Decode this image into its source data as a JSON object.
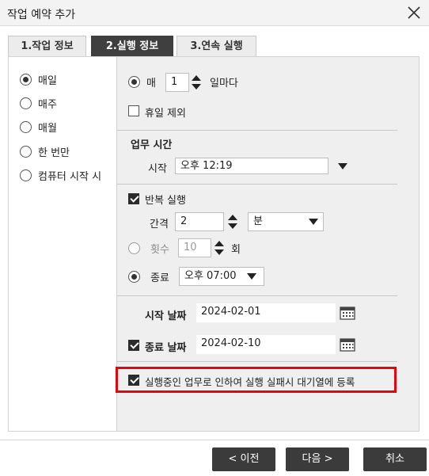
{
  "window": {
    "title": "작업 예약 추가"
  },
  "tabs": [
    {
      "label": "1.작업 정보"
    },
    {
      "label": "2.실행 정보"
    },
    {
      "label": "3.연속 실행"
    }
  ],
  "frequency": {
    "options": [
      "매일",
      "매주",
      "매월",
      "한 번만",
      "컴퓨터 시작 시"
    ],
    "selected": "매일"
  },
  "daily": {
    "prefix": "매",
    "interval_value": "1",
    "suffix": "일마다",
    "exclude_holidays_label": "휴일 제외",
    "exclude_holidays_checked": false
  },
  "work_time": {
    "heading": "업무 시간",
    "start_label": "시작",
    "start_value": "오후 12:19"
  },
  "repeat": {
    "label": "반복 실행",
    "checked": true,
    "interval_label": "간격",
    "interval_value": "2",
    "unit_value": "분",
    "count_label": "횟수",
    "count_value": "10",
    "count_suffix": "회",
    "end_label": "종료",
    "end_value": "오후 07:00",
    "selected_mode": "종료"
  },
  "dates": {
    "start_label": "시작 날짜",
    "start_value": "2024-02-01",
    "end_label": "종료 날짜",
    "end_value": "2024-02-10",
    "end_checked": true
  },
  "queue_on_fail": {
    "label": "실행중인 업무로 인하여 실행 실패시 대기열에 등록",
    "checked": true
  },
  "buttons": {
    "prev": "< 이전",
    "next": "다음 >",
    "cancel": "취소"
  },
  "colors": {
    "highlight": "#e4060d",
    "active_tab": "#3f3f3f",
    "button": "#3b3b3b"
  }
}
